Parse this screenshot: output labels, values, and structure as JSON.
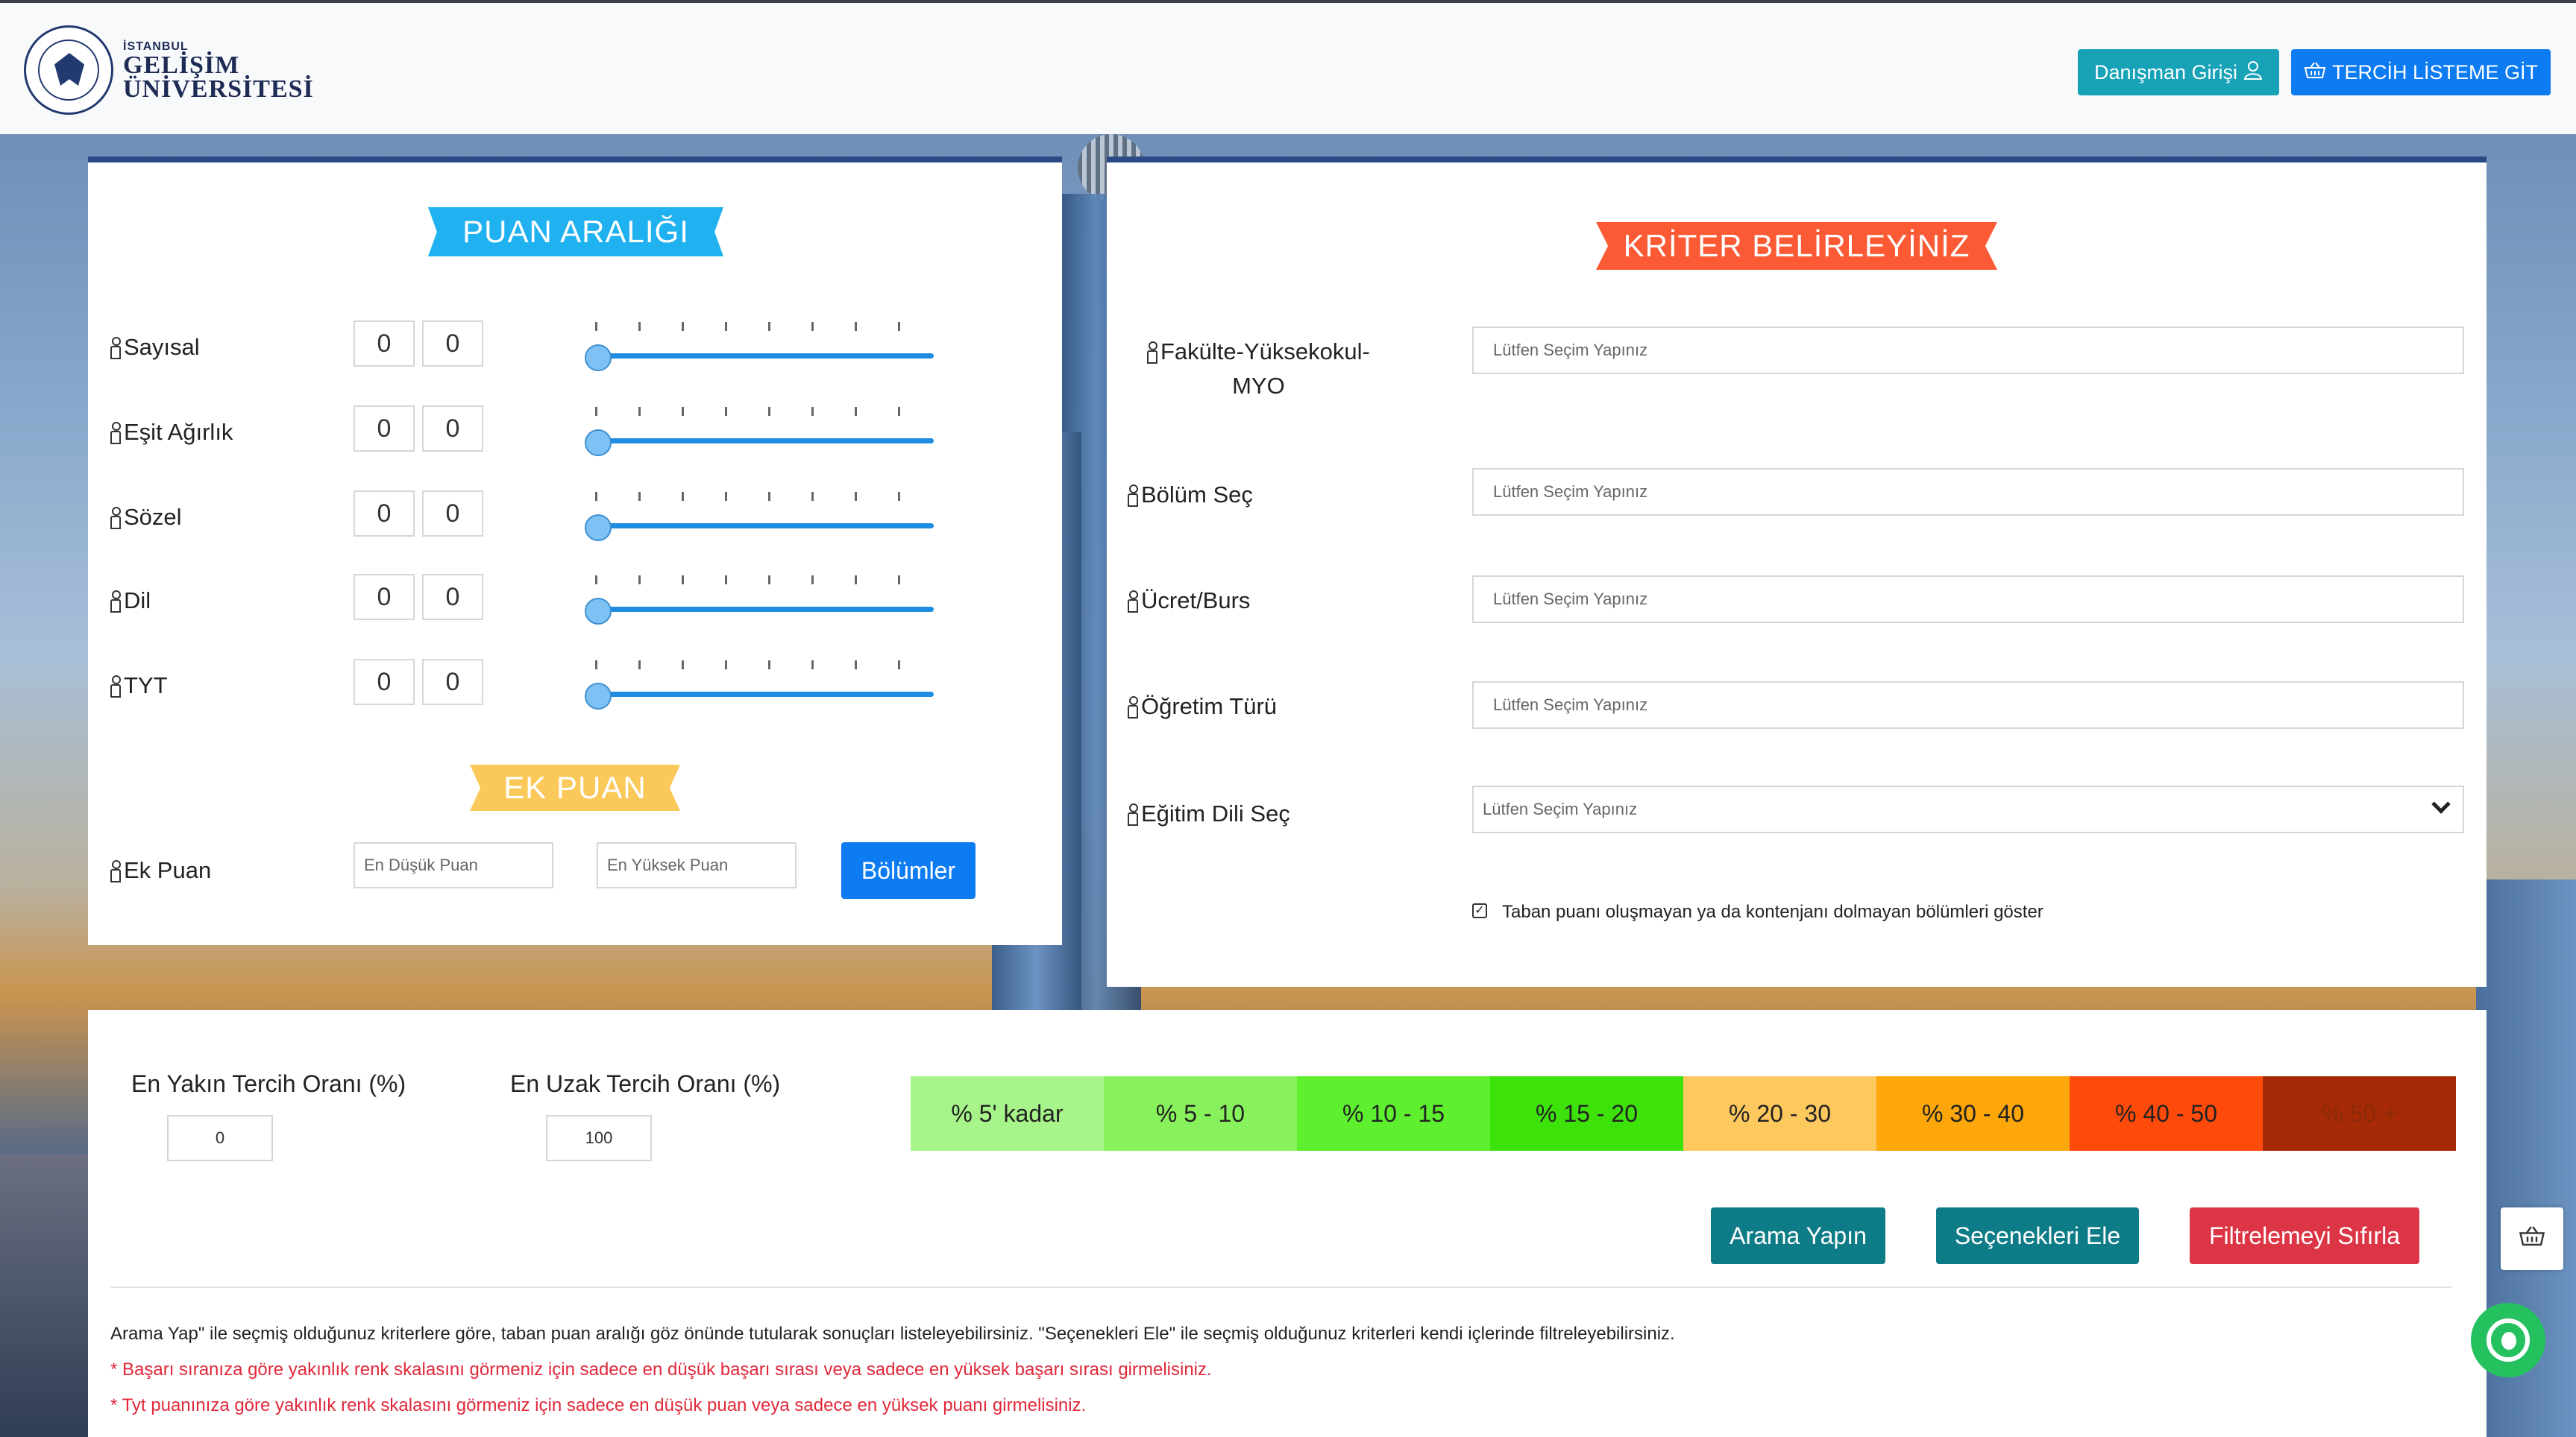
{
  "header": {
    "logo": {
      "line1": "İSTANBUL",
      "line2": "GELİŞİM",
      "line3": "ÜNİVERSİTESİ"
    },
    "danisman_label": "Danışman Girişi",
    "tercih_label": "TERCİH LİSTEME GİT"
  },
  "left_panel": {
    "title": "PUAN ARALIĞI",
    "rows": [
      {
        "label": "Sayısal",
        "min": "0",
        "max": "0",
        "level": 0
      },
      {
        "label": "Eşit Ağırlık",
        "min": "0",
        "max": "0",
        "level": 0
      },
      {
        "label": "Sözel",
        "min": "0",
        "max": "0",
        "level": 0
      },
      {
        "label": "Dil",
        "min": "0",
        "max": "0",
        "level": 0
      },
      {
        "label": "TYT",
        "min": "0",
        "max": "0",
        "level": 0
      }
    ],
    "ek_puan": {
      "title": "EK PUAN",
      "label": "Ek Puan",
      "min_placeholder": "En Düşük Puan",
      "max_placeholder": "En Yüksek Puan",
      "button": "Bölümler"
    }
  },
  "right_panel": {
    "title": "KRİTER BELİRLEYİNİZ",
    "fields": [
      {
        "label_line1": "Fakülte-Yüksekokul-",
        "label_line2": "MYO",
        "placeholder": "Lütfen Seçim Yapınız"
      },
      {
        "label": "Bölüm Seç",
        "placeholder": "Lütfen Seçim Yapınız"
      },
      {
        "label": "Ücret/Burs",
        "placeholder": "Lütfen Seçim Yapınız"
      },
      {
        "label": "Öğretim Türü",
        "placeholder": "Lütfen Seçim Yapınız"
      },
      {
        "label": "Eğitim Dili Seç",
        "selected": "Lütfen Seçim Yapınız"
      }
    ],
    "checkbox_label": "Taban puanı oluşmayan ya da kontenjanı dolmayan bölümleri göster",
    "checkbox_checked": true
  },
  "bottom": {
    "yakin_label": "En Yakın Tercih Oranı (%)",
    "yakin_value": "0",
    "uzak_label": "En Uzak Tercih Oranı (%)",
    "uzak_value": "100",
    "scale": [
      {
        "label": "% 5' kadar",
        "color": "#a7f58a"
      },
      {
        "label": "% 5 - 10",
        "color": "#88f25c"
      },
      {
        "label": "% 10 - 15",
        "color": "#5ef02f"
      },
      {
        "label": "% 15 - 20",
        "color": "#3ee20b"
      },
      {
        "label": "% 20 - 30",
        "color": "#fdc85e"
      },
      {
        "label": "% 30 - 40",
        "color": "#fda70a"
      },
      {
        "label": "% 40 - 50",
        "color": "#fe4b0b"
      },
      {
        "label": "% 50 +",
        "color": "#a52a05"
      }
    ],
    "buttons": {
      "arama": "Arama Yapın",
      "ele": "Seçenekleri Ele",
      "sifirla": "Filtrelemeyi Sıfırla"
    },
    "notes": {
      "info": "Arama Yap\" ile seçmiş olduğunuz kriterlere göre, taban puan aralığı göz önünde tutularak sonuçları listeleyebilirsiniz. \"Seçenekleri Ele\" ile seçmiş olduğunuz kriterleri kendi içlerinde filtreleyebilirsiniz.",
      "red1": "* Başarı sıranıza göre yakınlık renk skalasını görmeniz için sadece en düşük başarı sırası veya sadece en yüksek başarı sırası girmelisiniz.",
      "red2": "* Tyt puanınıza göre yakınlık renk skalasını görmeniz için sadece en düşük puan veya sadece en yüksek puanı girmelisiniz."
    }
  },
  "colors": {
    "accent_blue": "#0d7cf2",
    "teal": "#17a2b8",
    "button_dark_teal": "#0e7c86",
    "button_red": "#dc3545"
  }
}
